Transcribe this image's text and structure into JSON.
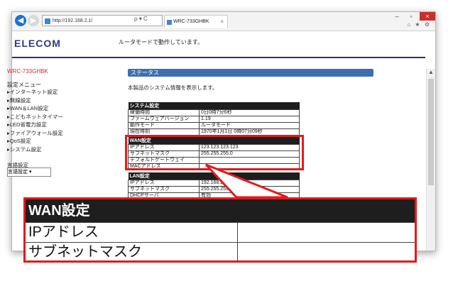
{
  "browser": {
    "address": "http://192.168.2.1/",
    "address_tools": "ρ ▾ C",
    "tab_title": "WRC-733GHBK",
    "tab_close": "×",
    "window_controls": [
      "–",
      "▫",
      "×"
    ],
    "toolbar_icons": "⌂ ★ ⚙"
  },
  "header": {
    "logo": "ELECOM",
    "mode_text": "ルータモードで動作しています。"
  },
  "sidebar": {
    "model": "WRC-733GHBK",
    "menu_title": "設定メニュー",
    "items": [
      "▸インターネット設定",
      "▸無線設定",
      "▸WAN＆LAN設定",
      "▸こどもネットタイマー",
      "▸LED省電力設定",
      "▸ファイアウォール設定",
      "▸QoS設定",
      "▸システム設定"
    ],
    "lang_label": "言語設定",
    "lang_value": "言語設定 ▾"
  },
  "main": {
    "section_title": "ステータス",
    "description": "本製品のシステム情報を表示します。",
    "system": {
      "title": "システム設定",
      "rows": [
        [
          "稼働時間",
          "0日0時7分6秒"
        ],
        [
          "ファームウェアバージョン",
          "1.19"
        ],
        [
          "動作モード",
          "ルータモード"
        ],
        [
          "現在時刻",
          "1970年1月1日 0時07分09秒"
        ]
      ]
    },
    "wan": {
      "title": "WAN設定",
      "rows": [
        [
          "IPアドレス",
          "123.123.123.123"
        ],
        [
          "サブネットマスク",
          "255.255.255.0"
        ],
        [
          "デフォルトゲートウェイ",
          ""
        ],
        [
          "MACアドレス",
          ""
        ]
      ]
    },
    "lan": {
      "title": "LAN設定",
      "rows": [
        [
          "IPアドレス",
          "192.168.2.1"
        ],
        [
          "サブネットマスク",
          "255.255.255.0"
        ],
        [
          "DHCPサーバ",
          "有効"
        ]
      ]
    }
  },
  "zoom": {
    "title": "WAN設定",
    "rows": [
      "IPアドレス",
      "サブネットマスク"
    ]
  },
  "colors": {
    "highlight": "#e21b1b",
    "header_bar": "#3d6fb0",
    "logo": "#2b3a8a",
    "model": "#d42a2a"
  }
}
